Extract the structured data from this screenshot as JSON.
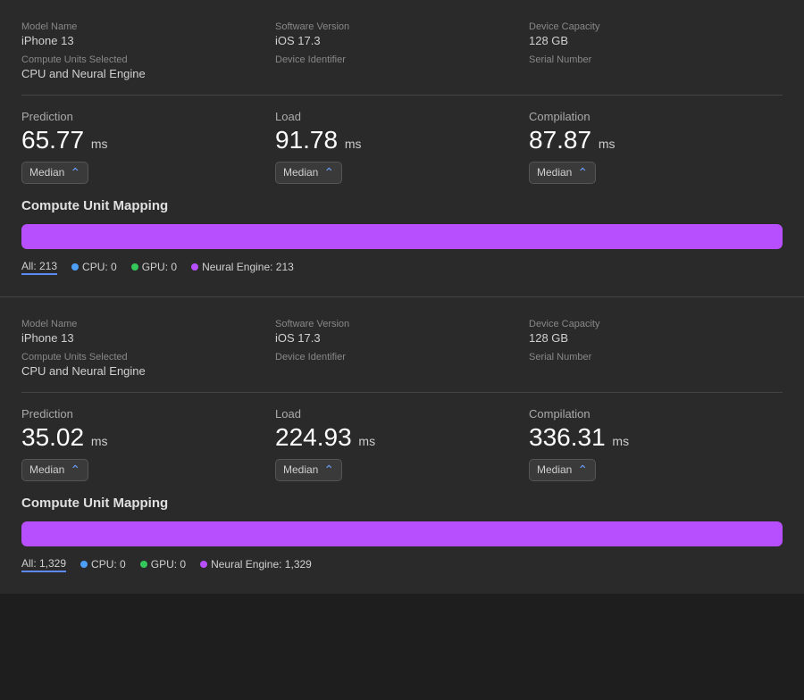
{
  "panels": [
    {
      "id": "panel-1",
      "info": {
        "model_name_label": "Model Name",
        "model_name_value": "iPhone 13",
        "software_version_label": "Software Version",
        "software_version_value": "iOS 17.3",
        "device_capacity_label": "Device Capacity",
        "device_capacity_value": "128 GB",
        "compute_units_label": "Compute Units Selected",
        "compute_units_value": "CPU and Neural Engine",
        "device_identifier_label": "Device Identifier",
        "device_identifier_value": "",
        "serial_number_label": "Serial Number",
        "serial_number_value": ""
      },
      "metrics": [
        {
          "label": "Prediction",
          "value": "65.77",
          "unit": "ms",
          "dropdown": "Median"
        },
        {
          "label": "Load",
          "value": "91.78",
          "unit": "ms",
          "dropdown": "Median"
        },
        {
          "label": "Compilation",
          "value": "87.87",
          "unit": "ms",
          "dropdown": "Median"
        }
      ],
      "compute_unit_mapping": {
        "title": "Compute Unit Mapping",
        "bar_fill_percent": 100,
        "legend": {
          "all_label": "All: 213",
          "cpu_label": "CPU: 0",
          "gpu_label": "GPU: 0",
          "neural_label": "Neural Engine: 213"
        }
      }
    },
    {
      "id": "panel-2",
      "info": {
        "model_name_label": "Model Name",
        "model_name_value": "iPhone 13",
        "software_version_label": "Software Version",
        "software_version_value": "iOS 17.3",
        "device_capacity_label": "Device Capacity",
        "device_capacity_value": "128 GB",
        "compute_units_label": "Compute Units Selected",
        "compute_units_value": "CPU and Neural Engine",
        "device_identifier_label": "Device Identifier",
        "device_identifier_value": "",
        "serial_number_label": "Serial Number",
        "serial_number_value": ""
      },
      "metrics": [
        {
          "label": "Prediction",
          "value": "35.02",
          "unit": "ms",
          "dropdown": "Median"
        },
        {
          "label": "Load",
          "value": "224.93",
          "unit": "ms",
          "dropdown": "Median"
        },
        {
          "label": "Compilation",
          "value": "336.31",
          "unit": "ms",
          "dropdown": "Median"
        }
      ],
      "compute_unit_mapping": {
        "title": "Compute Unit Mapping",
        "bar_fill_percent": 100,
        "legend": {
          "all_label": "All: 1,329",
          "cpu_label": "CPU: 0",
          "gpu_label": "GPU: 0",
          "neural_label": "Neural Engine: 1,329"
        }
      }
    }
  ],
  "dropdown_arrow": "⌃",
  "colors": {
    "neural_bar": "#b84fff",
    "cpu_dot": "#4d9ef5",
    "gpu_dot": "#34c759",
    "neural_dot": "#b84fff"
  }
}
